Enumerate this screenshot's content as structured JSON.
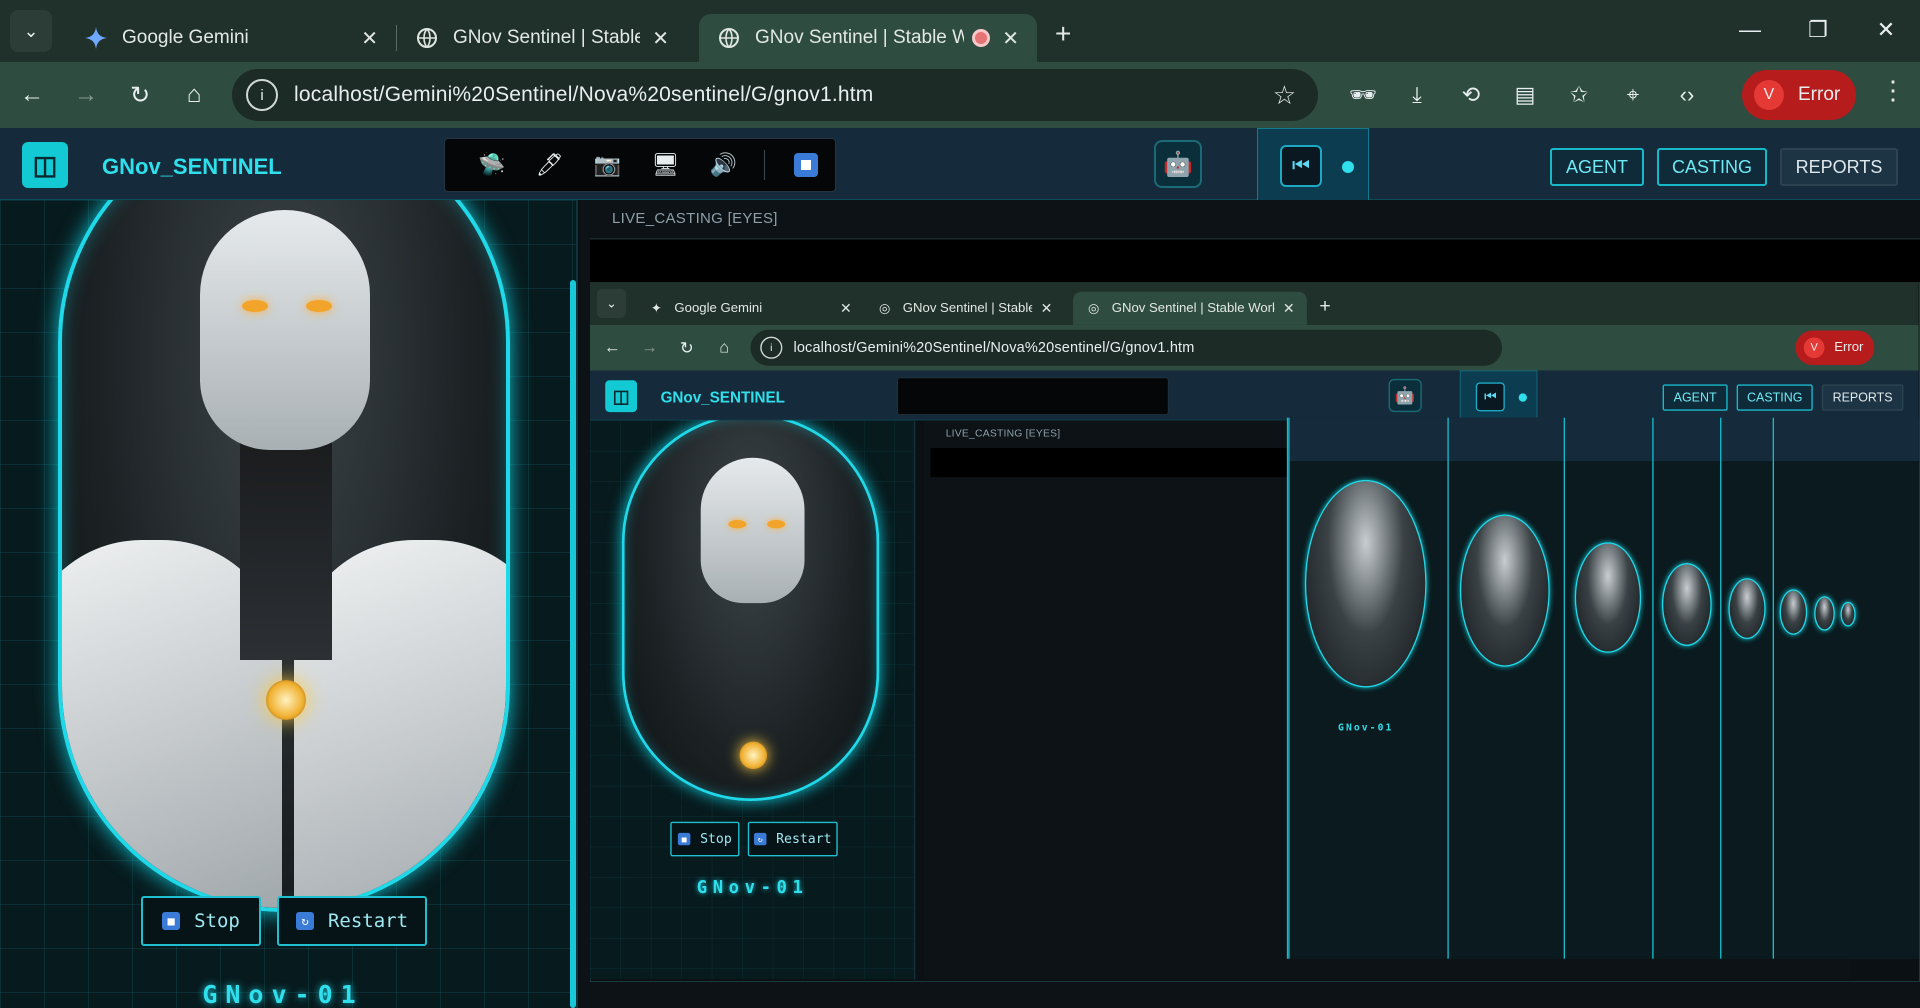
{
  "browser": {
    "tabs": [
      {
        "label": "Google Gemini",
        "icon": "gemini-icon",
        "active": false
      },
      {
        "label": "GNov Sentinel | Stable Workspa",
        "icon": "globe-icon",
        "active": false
      },
      {
        "label": "GNov Sentinel | Stable Work",
        "icon": "globe-icon",
        "active": true
      }
    ],
    "url": "localhost/Gemini%20Sentinel/Nova%20sentinel/G/gnov1.htm",
    "profile_initial": "V",
    "profile_status": "Error"
  },
  "app": {
    "brand": "GNov_SENTINEL",
    "nav": {
      "agent": "AGENT",
      "casting": "CASTING",
      "reports": "REPORTS"
    },
    "cast_panel_label": "LIVE_CASTING [EYES]",
    "controls": {
      "stop": "Stop",
      "restart": "Restart"
    },
    "unit_name": "GNov-01",
    "accent": "#2fe0ec",
    "toolbox_icons": [
      "ufo-icon",
      "pen-icon",
      "camera-icon",
      "monitor-icon",
      "speaker-icon",
      "stop-square-icon"
    ]
  }
}
